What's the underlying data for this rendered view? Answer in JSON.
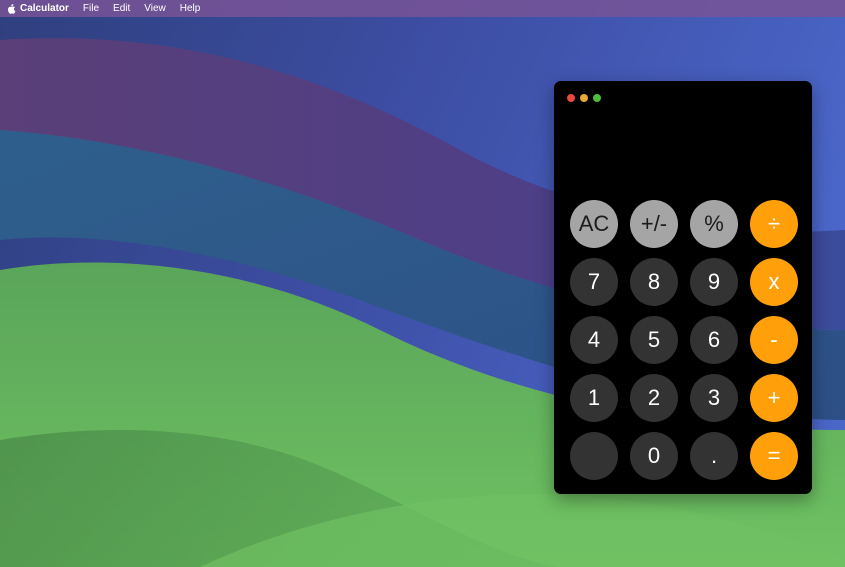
{
  "menubar": {
    "app_name": "Calculator",
    "items": [
      "File",
      "Edit",
      "View",
      "Help"
    ]
  },
  "calculator": {
    "display": "",
    "rows": [
      [
        {
          "label": "AC",
          "kind": "fn",
          "name": "clear-button"
        },
        {
          "label": "+/-",
          "kind": "fn",
          "name": "sign-toggle-button"
        },
        {
          "label": "%",
          "kind": "fn",
          "name": "percent-button"
        },
        {
          "label": "÷",
          "kind": "op",
          "name": "divide-button"
        }
      ],
      [
        {
          "label": "7",
          "kind": "num",
          "name": "digit-7-button"
        },
        {
          "label": "8",
          "kind": "num",
          "name": "digit-8-button"
        },
        {
          "label": "9",
          "kind": "num",
          "name": "digit-9-button"
        },
        {
          "label": "x",
          "kind": "op",
          "name": "multiply-button"
        }
      ],
      [
        {
          "label": "4",
          "kind": "num",
          "name": "digit-4-button"
        },
        {
          "label": "5",
          "kind": "num",
          "name": "digit-5-button"
        },
        {
          "label": "6",
          "kind": "num",
          "name": "digit-6-button"
        },
        {
          "label": "-",
          "kind": "op",
          "name": "subtract-button"
        }
      ],
      [
        {
          "label": "1",
          "kind": "num",
          "name": "digit-1-button"
        },
        {
          "label": "2",
          "kind": "num",
          "name": "digit-2-button"
        },
        {
          "label": "3",
          "kind": "num",
          "name": "digit-3-button"
        },
        {
          "label": "+",
          "kind": "op",
          "name": "add-button"
        }
      ],
      [
        {
          "label": "",
          "kind": "num",
          "name": "blank-button"
        },
        {
          "label": "0",
          "kind": "num",
          "name": "digit-0-button"
        },
        {
          "label": ".",
          "kind": "num",
          "name": "decimal-button"
        },
        {
          "label": "=",
          "kind": "op",
          "name": "equals-button"
        }
      ]
    ]
  },
  "colors": {
    "function_key": "#a5a5a5",
    "number_key": "#333333",
    "operator_key": "#ff9f0a",
    "window_background": "#000000",
    "close": "#e9473f",
    "minimize": "#e8a93a",
    "maximize": "#4fbb3e"
  }
}
